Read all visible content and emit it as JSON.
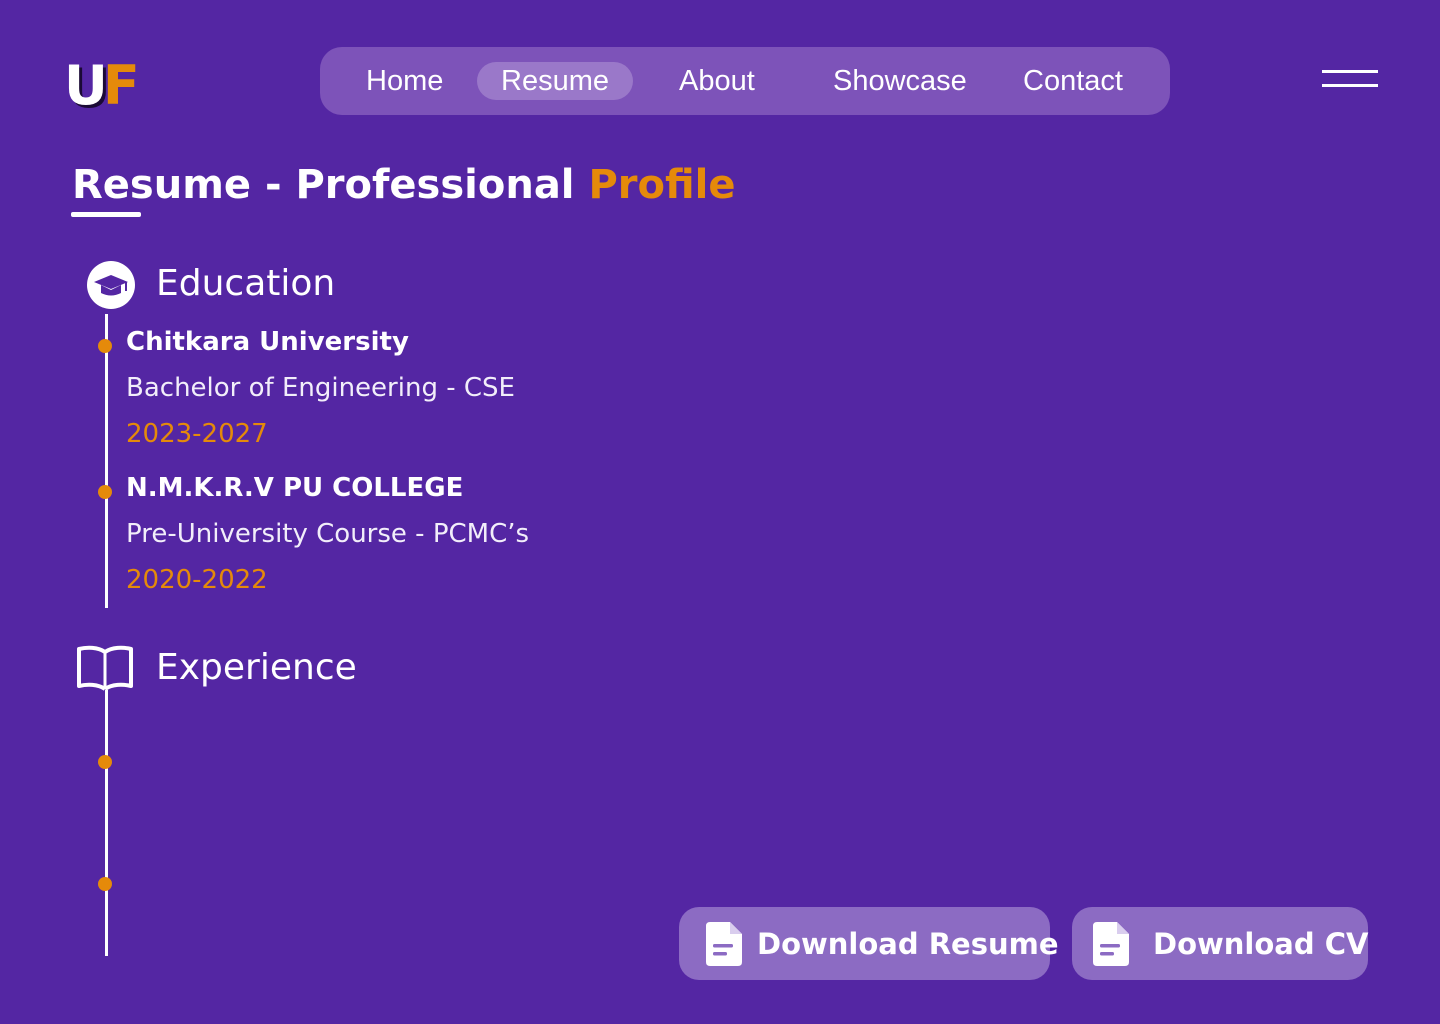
{
  "logo": {
    "letter_u": "U",
    "letter_f": "F"
  },
  "nav": {
    "items": [
      {
        "label": "Home"
      },
      {
        "label": "Resume",
        "active": true
      },
      {
        "label": "About"
      },
      {
        "label": "Showcase"
      },
      {
        "label": "Contact"
      }
    ]
  },
  "header": {
    "menu_icon": "hamburger-menu-icon"
  },
  "page": {
    "title_main": "Resume - Professional ",
    "title_accent": "Profile"
  },
  "education": {
    "heading": "Education",
    "icon": "graduation-cap-icon",
    "entries": [
      {
        "institution": "Chitkara University",
        "degree": "Bachelor of Engineering - CSE",
        "years": "2023-2027"
      },
      {
        "institution": "N.M.K.R.V PU COLLEGE",
        "degree": "Pre-University Course - PCMC’s",
        "years": "2020-2022"
      }
    ]
  },
  "experience": {
    "heading": "Experience",
    "icon": "open-book-icon"
  },
  "buttons": {
    "download_resume": "Download Resume",
    "download_cv": "Download CV",
    "icon": "document-icon"
  },
  "colors": {
    "background": "#5426a3",
    "nav_bg": "#7d53b9",
    "nav_active": "#9a78c9",
    "accent": "#e58a0a",
    "button_bg": "#8c6bc3",
    "text": "#ffffff"
  }
}
